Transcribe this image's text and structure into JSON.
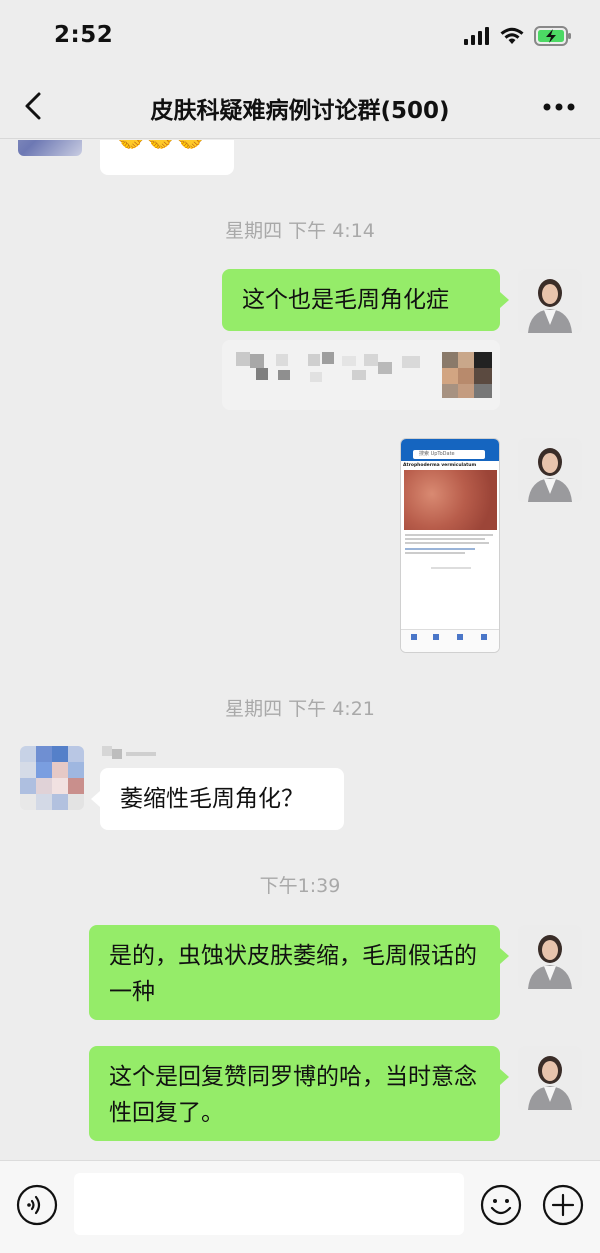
{
  "status_bar": {
    "time": "2:52"
  },
  "nav": {
    "title": "皮肤科疑难病例讨论群(500)"
  },
  "chat": {
    "timestamps": [
      "星期四 下午 4:14",
      "星期四 下午 4:21",
      "下午1:39"
    ],
    "messages": [
      {
        "from": "me",
        "text": "这个也是毛周角化症"
      },
      {
        "from": "me",
        "text": "是的，虫蚀状皮肤萎缩，毛周假话的一种"
      },
      {
        "from": "me",
        "text": "这个是回复赞同罗博的哈，当时意念性回复了。"
      },
      {
        "from": "other",
        "text": "萎缩性毛周角化？"
      }
    ],
    "emoji_row": "🤝🤝🤝",
    "screenshot_card": {
      "search_text": "搜索 UpToDate",
      "heading": "Atrophoderma vermiculatum"
    }
  },
  "colors": {
    "my_bubble": "#95ec69",
    "other_bubble": "#ffffff",
    "background": "#ededed"
  },
  "icons": [
    "back-icon",
    "more-icon",
    "voice-icon",
    "emoji-icon",
    "plus-icon",
    "signal-icon",
    "wifi-icon",
    "battery-icon"
  ]
}
